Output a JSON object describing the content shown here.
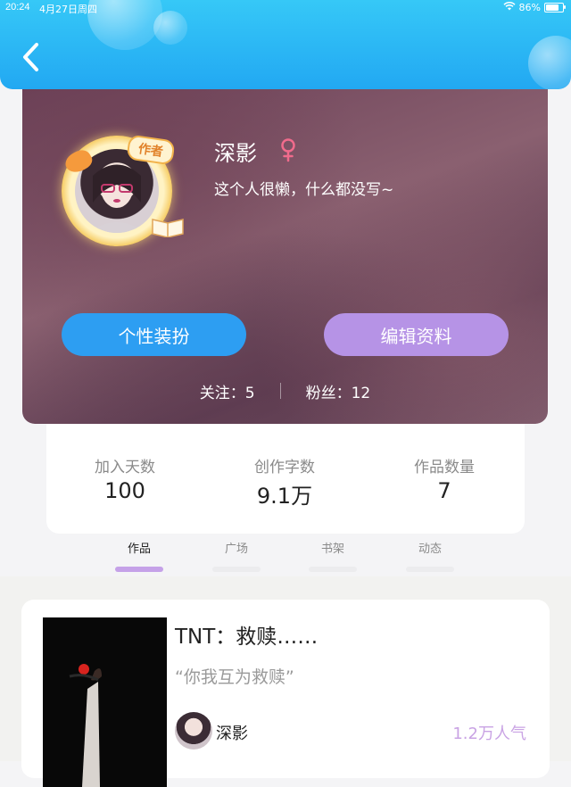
{
  "status_bar": {
    "time": "20:24",
    "date": "4月27日周四",
    "battery": "86%",
    "battery_level": 0.86
  },
  "profile": {
    "avatar_badge": "作者",
    "username": "深影",
    "gender": "female",
    "signature": "这个人很懒，什么都没写~",
    "buttons": {
      "style": "个性装扮",
      "edit": "编辑资料"
    },
    "following_label": "关注：",
    "following_count": "5",
    "fans_label": "粉丝：",
    "fans_count": "12"
  },
  "stats": [
    {
      "label": "加入天数",
      "value": "100"
    },
    {
      "label": "创作字数",
      "value": "9.1万"
    },
    {
      "label": "作品数量",
      "value": "7"
    }
  ],
  "tabs": [
    {
      "label": "作品",
      "active": true
    },
    {
      "label": "广场",
      "active": false
    },
    {
      "label": "书架",
      "active": false
    },
    {
      "label": "动态",
      "active": false
    }
  ],
  "work": {
    "title": "TNT：救赎……",
    "description": "“你我互为救赎”",
    "author": "深影",
    "popularity": "1.2万人气"
  },
  "colors": {
    "header": "#22a8f2",
    "style_button": "#2d9ef2",
    "edit_button": "#b693e6",
    "tab_indicator_active": "#c5a1e8",
    "popularity": "#c9a3e4",
    "gender_icon": "#f06b8c"
  },
  "icons": {
    "back": "chevron-left-icon",
    "wifi": "wifi-icon",
    "battery": "battery-icon",
    "gender": "female-icon"
  }
}
